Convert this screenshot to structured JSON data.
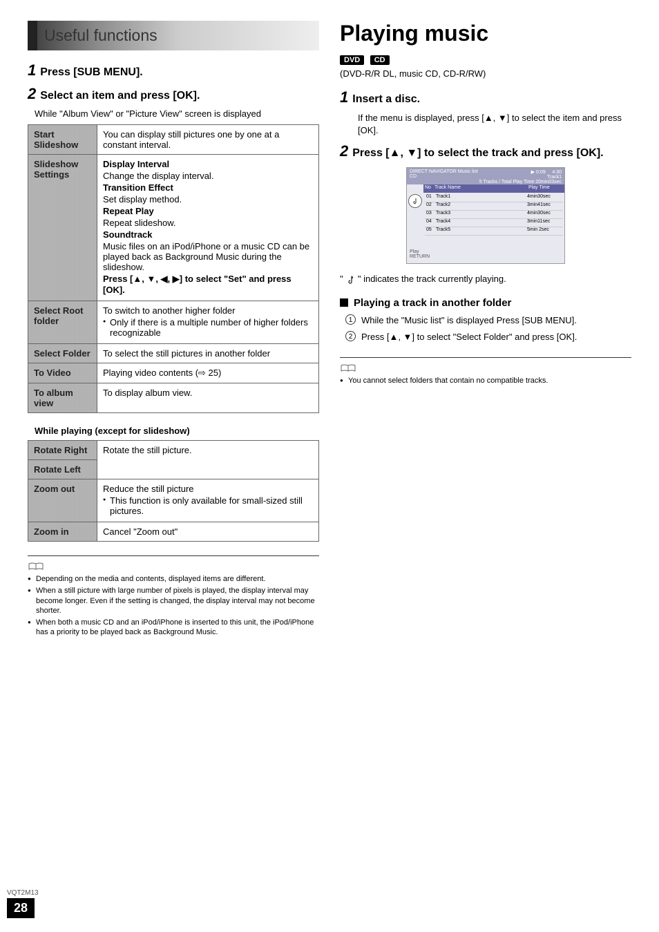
{
  "left": {
    "section_title": "Useful functions",
    "step1_num": "1",
    "step1_text": "Press [SUB MENU].",
    "step2_num": "2",
    "step2_text": "Select an item and press [OK].",
    "sub_note": "While \"Album View\" or \"Picture View\" screen is displayed",
    "rows": [
      {
        "label": "Start Slideshow",
        "body_plain": "You can display still pictures one by one at a constant interval."
      }
    ],
    "slideshow_settings_label": "Slideshow Settings",
    "slideshow_settings": {
      "b1": "Display Interval",
      "t1": "Change the display interval.",
      "b2": "Transition Effect",
      "t2": "Set display method.",
      "b3": "Repeat Play",
      "t3": "Repeat slideshow.",
      "b4": "Soundtrack",
      "t4": "Music files on an iPod/iPhone or a music CD can be played back as Background Music during the slideshow.",
      "b5": "Press [▲, ▼, ◀, ▶] to select \"Set\" and press [OK]."
    },
    "select_root_label": "Select Root folder",
    "select_root": {
      "t1": "To switch to another higher folder",
      "t2": "Only if there is a multiple number of higher folders recognizable"
    },
    "select_folder_label": "Select Folder",
    "select_folder_body": "To select the still pictures in another folder",
    "to_video_label": "To Video",
    "to_video_body": "Playing video contents (⇨ 25)",
    "to_album_label": "To album view",
    "to_album_body": "To display album view.",
    "while_playing_head": "While playing (except for slideshow)",
    "rotate_right_label": "Rotate Right",
    "rotate_left_label": "Rotate Left",
    "rotate_body": "Rotate the still picture.",
    "zoom_out_label": "Zoom out",
    "zoom_out": {
      "t1": "Reduce the still picture",
      "t2": "This function is only available for small-sized still pictures."
    },
    "zoom_in_label": "Zoom in",
    "zoom_in_body": "Cancel \"Zoom out\"",
    "notes": [
      "Depending on the media and contents, displayed items are different.",
      "When a still picture with large number of pixels is played, the display interval may become longer. Even if the setting is changed, the display interval may not become shorter.",
      "When both a music CD and an iPod/iPhone is inserted to this unit, the iPod/iPhone has a priority to be played back as Background Music."
    ]
  },
  "right": {
    "title": "Playing music",
    "badge1": "DVD",
    "badge2": "CD",
    "media_sub": "(DVD-R/R DL, music CD, CD-R/RW)",
    "step1_num": "1",
    "step1_text": "Insert a disc.",
    "step1_sub": "If the menu is displayed, press [▲, ▼] to select the item and press [OK].",
    "step2_num": "2",
    "step2_text": "Press [▲, ▼] to select the track and press [OK].",
    "screen": {
      "top_left1": "DIRECT NAVIGATOR",
      "top_left2": "CD",
      "top_mid": "Music list",
      "play_icon": "▶",
      "time_cur": "0:09",
      "time_total": "4:30",
      "now_playing": "Track1",
      "summary": "5 Tracks / Total Play Time 20min03sec",
      "col_no": "No",
      "col_name": "Track Name",
      "col_time": "Play Time",
      "tracks": [
        {
          "no": "01",
          "name": "Track1",
          "time": "4min30sec"
        },
        {
          "no": "02",
          "name": "Track2",
          "time": "3min41sec"
        },
        {
          "no": "03",
          "name": "Track3",
          "time": "4min30sec"
        },
        {
          "no": "04",
          "name": "Track4",
          "time": "3min11sec"
        },
        {
          "no": "05",
          "name": "Track5",
          "time": "5min 2sec"
        }
      ],
      "footer1": "Play",
      "footer2": "RETURN"
    },
    "track_indicator_pre": "\" ",
    "track_indicator_post": " \" indicates the track currently playing.",
    "sub_folder_head": "Playing a track in another folder",
    "folder_step1": "While the \"Music list\" is displayed Press [SUB MENU].",
    "folder_step2": "Press [▲, ▼] to select \"Select Folder\" and press [OK].",
    "right_note": "You cannot select folders that contain no compatible tracks."
  },
  "footer": {
    "code": "VQT2M13",
    "page": "28"
  }
}
